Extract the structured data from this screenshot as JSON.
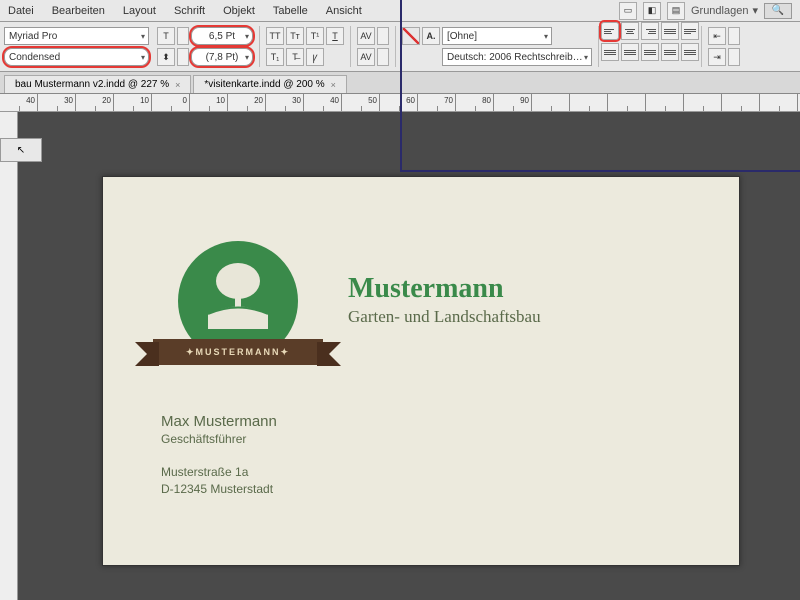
{
  "menu": {
    "items": [
      "Datei",
      "Bearbeiten",
      "Layout",
      "Schrift",
      "Objekt",
      "Tabelle",
      "Ansicht"
    ],
    "basics": "Grundlagen"
  },
  "control": {
    "font": "Myriad Pro",
    "style": "Condensed",
    "size": "6,5 Pt",
    "leading": "(7,8 Pt)",
    "swatch": "[Ohne]",
    "lang": "Deutsch: 2006 Rechtschreib…"
  },
  "tabs": [
    {
      "label": "bau Mustermann v2.indd @ 227 %"
    },
    {
      "label": "*visitenkarte.indd @ 200 %"
    }
  ],
  "ruler_vals": [
    "40",
    "30",
    "20",
    "10",
    "0",
    "10",
    "20",
    "30",
    "40",
    "50",
    "60",
    "70",
    "80",
    "90"
  ],
  "card": {
    "company": "Mustermann",
    "tagline": "Garten- und Landschaftsbau",
    "logo_label": "MUSTERMANN",
    "name": "Max Mustermann",
    "role": "Geschäftsführer",
    "street": "Musterstraße 1a",
    "city": "D-12345 Musterstadt"
  },
  "colors": {
    "brand_green": "#3a8a4a",
    "ribbon": "#5a3d28",
    "highlight": "#e53935"
  }
}
